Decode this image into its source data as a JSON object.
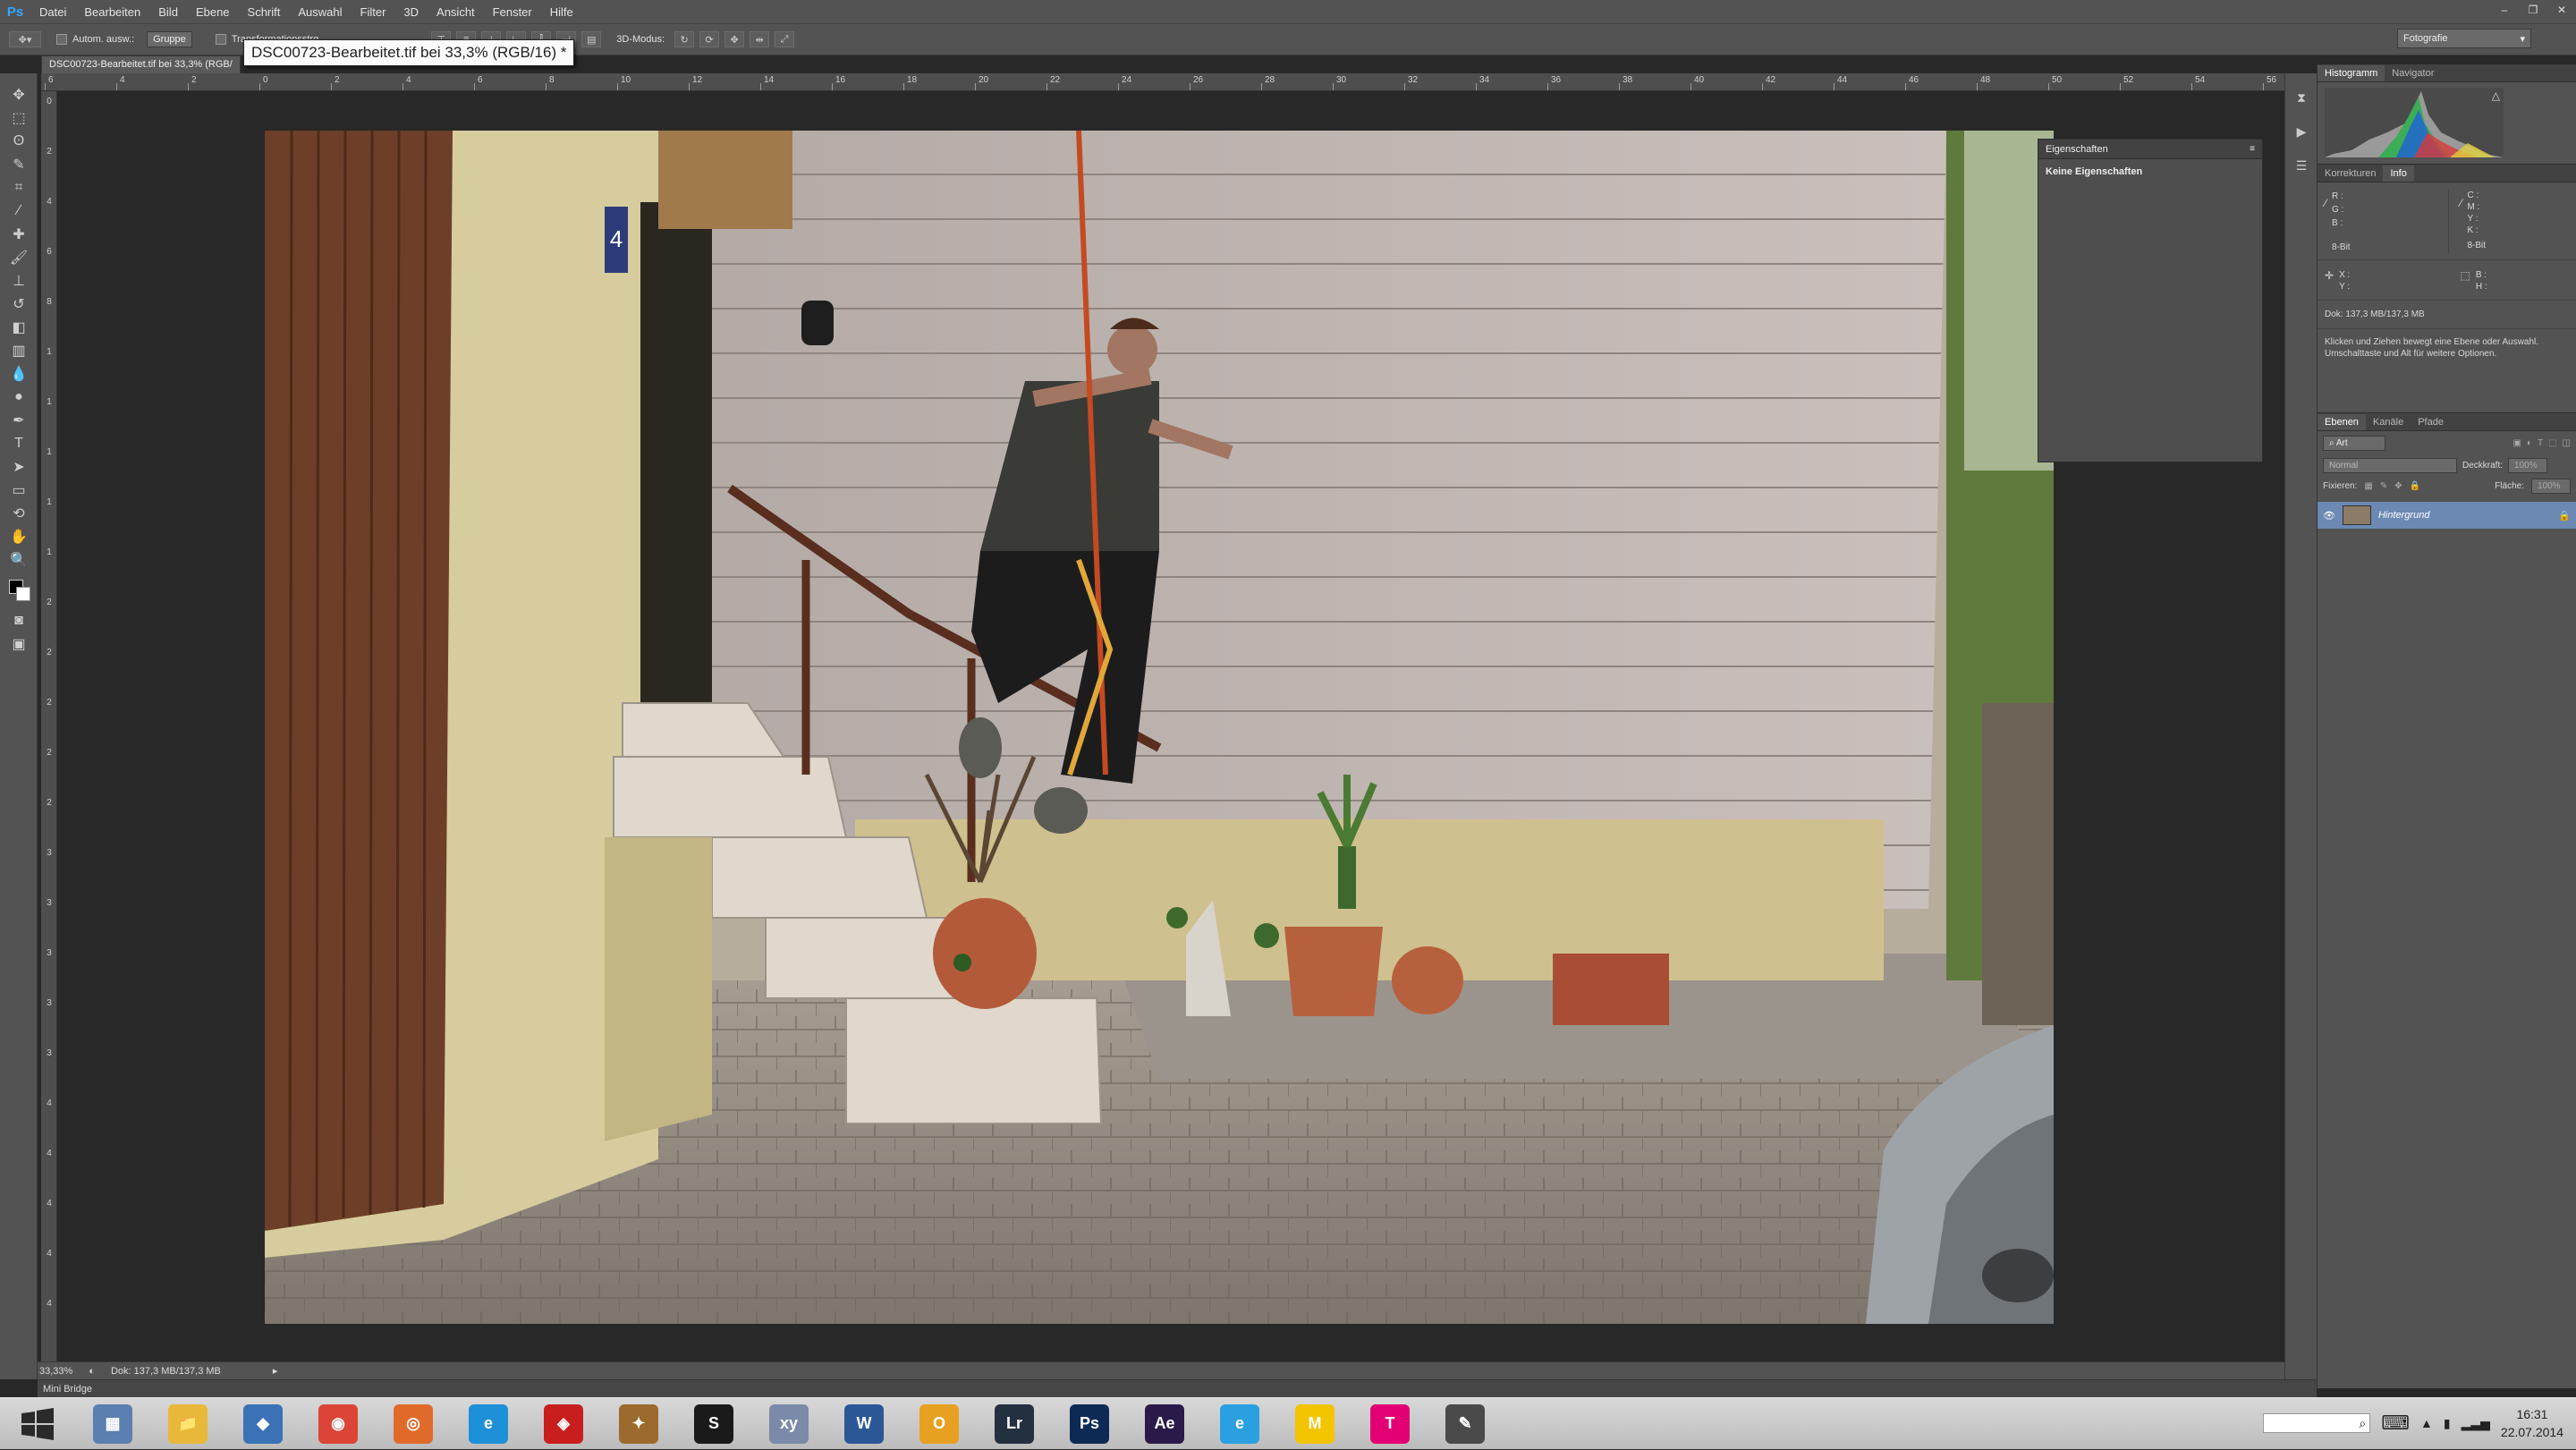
{
  "app": {
    "logo": "Ps"
  },
  "menu": [
    "Datei",
    "Bearbeiten",
    "Bild",
    "Ebene",
    "Schrift",
    "Auswahl",
    "Filter",
    "3D",
    "Ansicht",
    "Fenster",
    "Hilfe"
  ],
  "window_controls": {
    "minimize": "–",
    "restore": "❐",
    "close": "✕"
  },
  "options_bar": {
    "auto_select_label": "Autom. ausw.:",
    "group_value": "Gruppe",
    "transform_label": "Transformationsstrg.",
    "mode_label": "3D-Modus:",
    "workspace": "Fotografie"
  },
  "document": {
    "tab_title": "DSC00723-Bearbeitet.tif bei 33,3% (RGB/",
    "tooltip": "DSC00723-Bearbeitet.tif bei 33,3% (RGB/16) *"
  },
  "ruler_top": [
    "6",
    "4",
    "2",
    "0",
    "2",
    "4",
    "6",
    "8",
    "10",
    "12",
    "14",
    "16",
    "18",
    "20",
    "22",
    "24",
    "26",
    "28",
    "30",
    "32",
    "34",
    "36",
    "38",
    "40",
    "42",
    "44",
    "46",
    "48",
    "50",
    "52",
    "54",
    "56"
  ],
  "ruler_left": [
    "0",
    "2",
    "4",
    "6",
    "8",
    "1",
    "1",
    "1",
    "1",
    "1",
    "2",
    "2",
    "2",
    "2",
    "2",
    "3",
    "3",
    "3",
    "3",
    "3",
    "4",
    "4",
    "4",
    "4",
    "4"
  ],
  "properties_panel": {
    "title": "Eigenschaften",
    "body": "Keine Eigenschaften"
  },
  "histogram_panel": {
    "tabs": [
      "Histogramm",
      "Navigator"
    ],
    "warning_icon": "△"
  },
  "info_panel": {
    "tabs": [
      "Korrekturen",
      "Info"
    ],
    "left_channels": [
      "R :",
      "G :",
      "B :"
    ],
    "right_channels": [
      "C :",
      "M :",
      "Y :",
      "K :"
    ],
    "left_bit": "8-Bit",
    "right_bit": "8-Bit",
    "xy": [
      "X :",
      "Y :"
    ],
    "bh": [
      "B :",
      "H :"
    ],
    "doc_size": "Dok: 137,3 MB/137,3 MB",
    "hint": "Klicken und Ziehen bewegt eine Ebene oder Auswahl. Umschalttaste und Alt für weitere Optionen."
  },
  "layers_panel": {
    "tabs": [
      "Ebenen",
      "Kanäle",
      "Pfade"
    ],
    "filter_kind": "Art",
    "blend_mode": "Normal",
    "opacity_label": "Deckkraft:",
    "opacity_value": "100%",
    "lock_label": "Fixieren:",
    "fill_label": "Fläche:",
    "fill_value": "100%",
    "layers": [
      {
        "name": "Hintergrund",
        "visible": true,
        "locked": true
      }
    ]
  },
  "status_bar": {
    "zoom": "33,33%",
    "doc": "Dok: 137,3 MB/137,3 MB"
  },
  "mini_bridge": "Mini Bridge",
  "taskbar": {
    "apps": [
      {
        "name": "calculator",
        "label": "▦",
        "color": "#5a7fb0"
      },
      {
        "name": "explorer",
        "label": "📁",
        "color": "#e8b83a"
      },
      {
        "name": "app-blue",
        "label": "◆",
        "color": "#3a72b5"
      },
      {
        "name": "chrome",
        "label": "◉",
        "color": "#db4437"
      },
      {
        "name": "app-orange",
        "label": "◎",
        "color": "#e06a2a"
      },
      {
        "name": "internet-explorer",
        "label": "e",
        "color": "#1e90d8"
      },
      {
        "name": "app-red",
        "label": "◈",
        "color": "#c81e1e"
      },
      {
        "name": "app-wolf",
        "label": "✦",
        "color": "#9c6a2c"
      },
      {
        "name": "app-s",
        "label": "S",
        "color": "#1a1a1a"
      },
      {
        "name": "app-xy",
        "label": "xy",
        "color": "#7a8aa8"
      },
      {
        "name": "word",
        "label": "W",
        "color": "#2b5797"
      },
      {
        "name": "outlook",
        "label": "O",
        "color": "#e8a020"
      },
      {
        "name": "lightroom",
        "label": "Lr",
        "color": "#233040"
      },
      {
        "name": "photoshop",
        "label": "Ps",
        "color": "#0d2a55"
      },
      {
        "name": "after-effects",
        "label": "Ae",
        "color": "#2a1a4a"
      },
      {
        "name": "internet-explorer-2",
        "label": "e",
        "color": "#2aa0e0"
      },
      {
        "name": "mcdonalds",
        "label": "M",
        "color": "#f3c400"
      },
      {
        "name": "telekom",
        "label": "T",
        "color": "#e20074"
      },
      {
        "name": "app-dark",
        "label": "✎",
        "color": "#4a4a4a"
      }
    ],
    "time": "16:31",
    "date": "22.07.2014"
  }
}
